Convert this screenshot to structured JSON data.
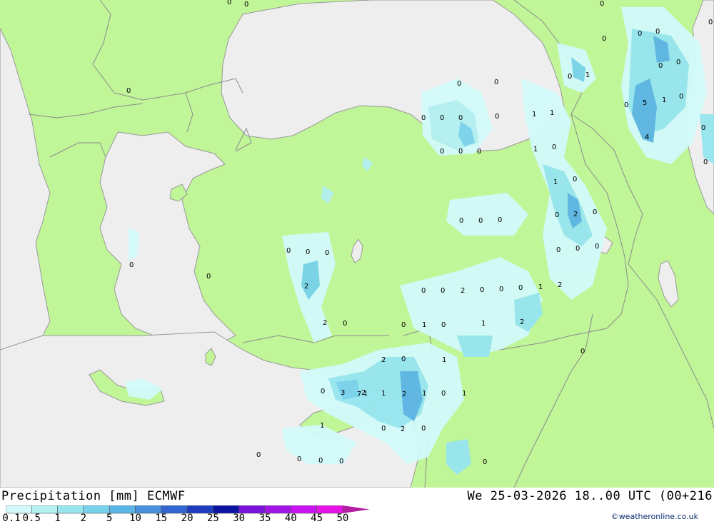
{
  "header": {
    "title": "Precipitation [mm] ECMWF",
    "datetime": "We 25-03-2026 18..00 UTC (00+216"
  },
  "legend": {
    "entries": [
      {
        "label": "0.1",
        "color": "#d2fafa"
      },
      {
        "label": "0.5",
        "color": "#b4f0f0"
      },
      {
        "label": "1",
        "color": "#96e6f0"
      },
      {
        "label": "2",
        "color": "#78d2eb"
      },
      {
        "label": "5",
        "color": "#5ab4e6"
      },
      {
        "label": "10",
        "color": "#4690dc"
      },
      {
        "label": "15",
        "color": "#3264d2"
      },
      {
        "label": "20",
        "color": "#1e3cbe"
      },
      {
        "label": "25",
        "color": "#0a14a0"
      },
      {
        "label": "30",
        "color": "#7814dc"
      },
      {
        "label": "35",
        "color": "#a014e6"
      },
      {
        "label": "40",
        "color": "#c814f0"
      },
      {
        "label": "45",
        "color": "#e614e6"
      },
      {
        "label": "50",
        "color": "#b41ea0"
      }
    ]
  },
  "credit": "©weatheronline.co.uk",
  "colors": {
    "land": "#c0f598",
    "sea": "#eeeeee",
    "border": "#999999"
  },
  "map_labels": [
    "0",
    "0",
    "0",
    "0",
    "0",
    "0",
    "0",
    "0",
    "0",
    "0",
    "0",
    "0",
    "0",
    "0",
    "0",
    "0",
    "0",
    "0",
    "0",
    "0",
    "0",
    "0",
    "0",
    "0",
    "0",
    "0",
    "0",
    "0",
    "0",
    "0",
    "0",
    "0",
    "0",
    "0",
    "0",
    "0",
    "0",
    "0",
    "0",
    "0",
    "0",
    "0",
    "0",
    "0",
    "0",
    "0",
    "0",
    "0",
    "0",
    "0",
    "0",
    "0",
    "0",
    "0",
    "0",
    "0",
    "0",
    "0",
    "1",
    "1",
    "1",
    "1",
    "1",
    "1",
    "1",
    "1",
    "1",
    "1",
    "1",
    "1",
    "1",
    "1",
    "1",
    "2",
    "2",
    "2",
    "2",
    "2",
    "2",
    "2",
    "2",
    "2",
    "2",
    "3",
    "4",
    "5",
    "7"
  ]
}
